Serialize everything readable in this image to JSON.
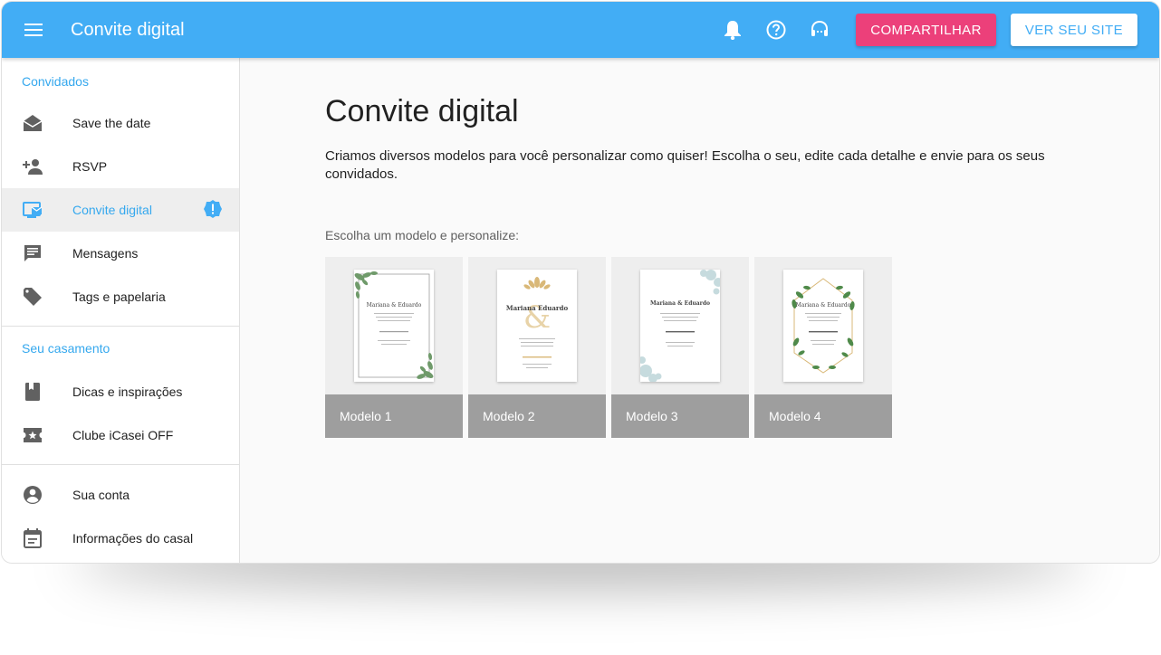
{
  "header": {
    "title": "Convite digital",
    "share_label": "COMPARTILHAR",
    "site_label": "VER SEU SITE"
  },
  "sidebar": {
    "sections": [
      {
        "title": "Convidados",
        "items": [
          {
            "label": "Save the date",
            "icon": "envelope-open-icon"
          },
          {
            "label": "RSVP",
            "icon": "person-add-icon"
          },
          {
            "label": "Convite digital",
            "icon": "devices-mail-icon",
            "active": true,
            "badge": "alert-badge-icon"
          },
          {
            "label": "Mensagens",
            "icon": "message-icon"
          },
          {
            "label": "Tags e papelaria",
            "icon": "tag-icon"
          }
        ]
      },
      {
        "title": "Seu casamento",
        "items": [
          {
            "label": "Dicas e inspirações",
            "icon": "book-icon"
          },
          {
            "label": "Clube iCasei OFF",
            "icon": "ticket-star-icon"
          }
        ]
      },
      {
        "title": "",
        "items": [
          {
            "label": "Sua conta",
            "icon": "account-circle-icon"
          },
          {
            "label": "Informações do casal",
            "icon": "calendar-icon"
          }
        ]
      }
    ]
  },
  "main": {
    "title": "Convite digital",
    "description": "Criamos diversos modelos para você personalizar como quiser! Escolha o seu, edite cada detalhe e envie para os seus convidados.",
    "choose_label": "Escolha um modelo e personalize:",
    "models": [
      {
        "label": "Modelo 1",
        "names": "Mariana & Eduardo"
      },
      {
        "label": "Modelo 2",
        "names": "Mariana Eduardo"
      },
      {
        "label": "Modelo 3",
        "names": "Mariana & Eduardo"
      },
      {
        "label": "Modelo 4",
        "names": "Mariana & Eduardo"
      }
    ]
  },
  "colors": {
    "accent": "#42adf5",
    "share": "#ec407a",
    "caption": "#9e9e9e"
  }
}
